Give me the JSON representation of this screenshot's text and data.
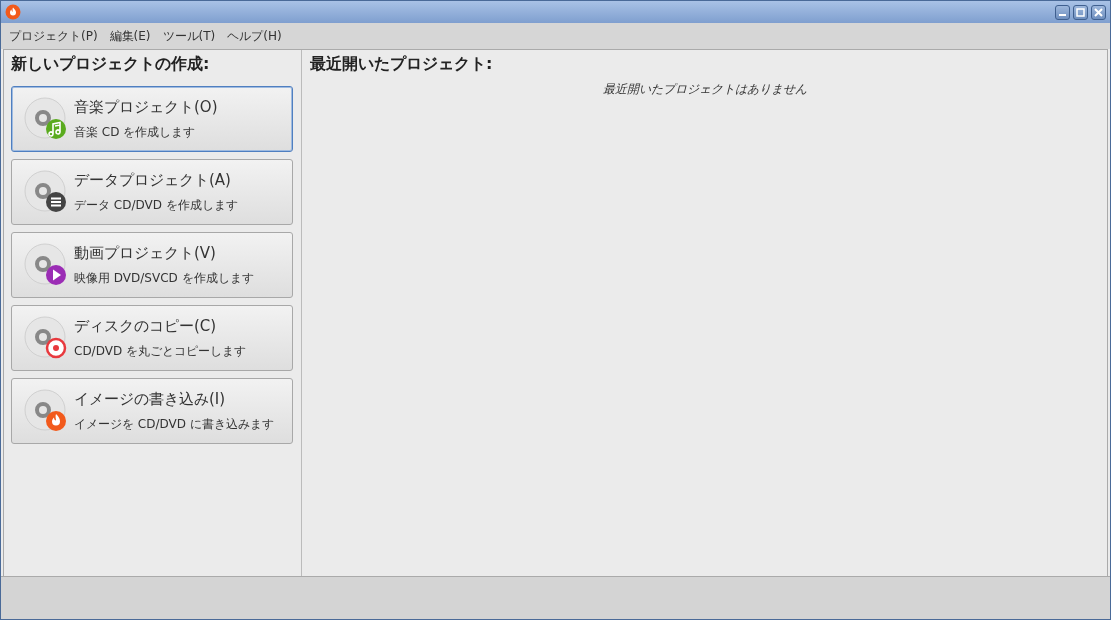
{
  "menu": [
    "プロジェクト(P)",
    "編集(E)",
    "ツール(T)",
    "ヘルプ(H)"
  ],
  "new_project": {
    "heading": "新しいプロジェクトの作成:",
    "buttons": [
      {
        "kind": "audio",
        "title": "音楽プロジェクト(O)",
        "subtitle": "音楽 CD を作成します",
        "selected": true
      },
      {
        "kind": "data",
        "title": "データプロジェクト(A)",
        "subtitle": "データ CD/DVD を作成します",
        "selected": false
      },
      {
        "kind": "video",
        "title": "動画プロジェクト(V)",
        "subtitle": "映像用 DVD/SVCD を作成します",
        "selected": false
      },
      {
        "kind": "copy",
        "title": "ディスクのコピー(C)",
        "subtitle": "CD/DVD を丸ごとコピーします",
        "selected": false
      },
      {
        "kind": "burn",
        "title": "イメージの書き込み(I)",
        "subtitle": "イメージを CD/DVD に書き込みます",
        "selected": false
      }
    ]
  },
  "recent": {
    "heading": "最近開いたプロジェクト:",
    "empty_message": "最近開いたプロジェクトはありません"
  }
}
